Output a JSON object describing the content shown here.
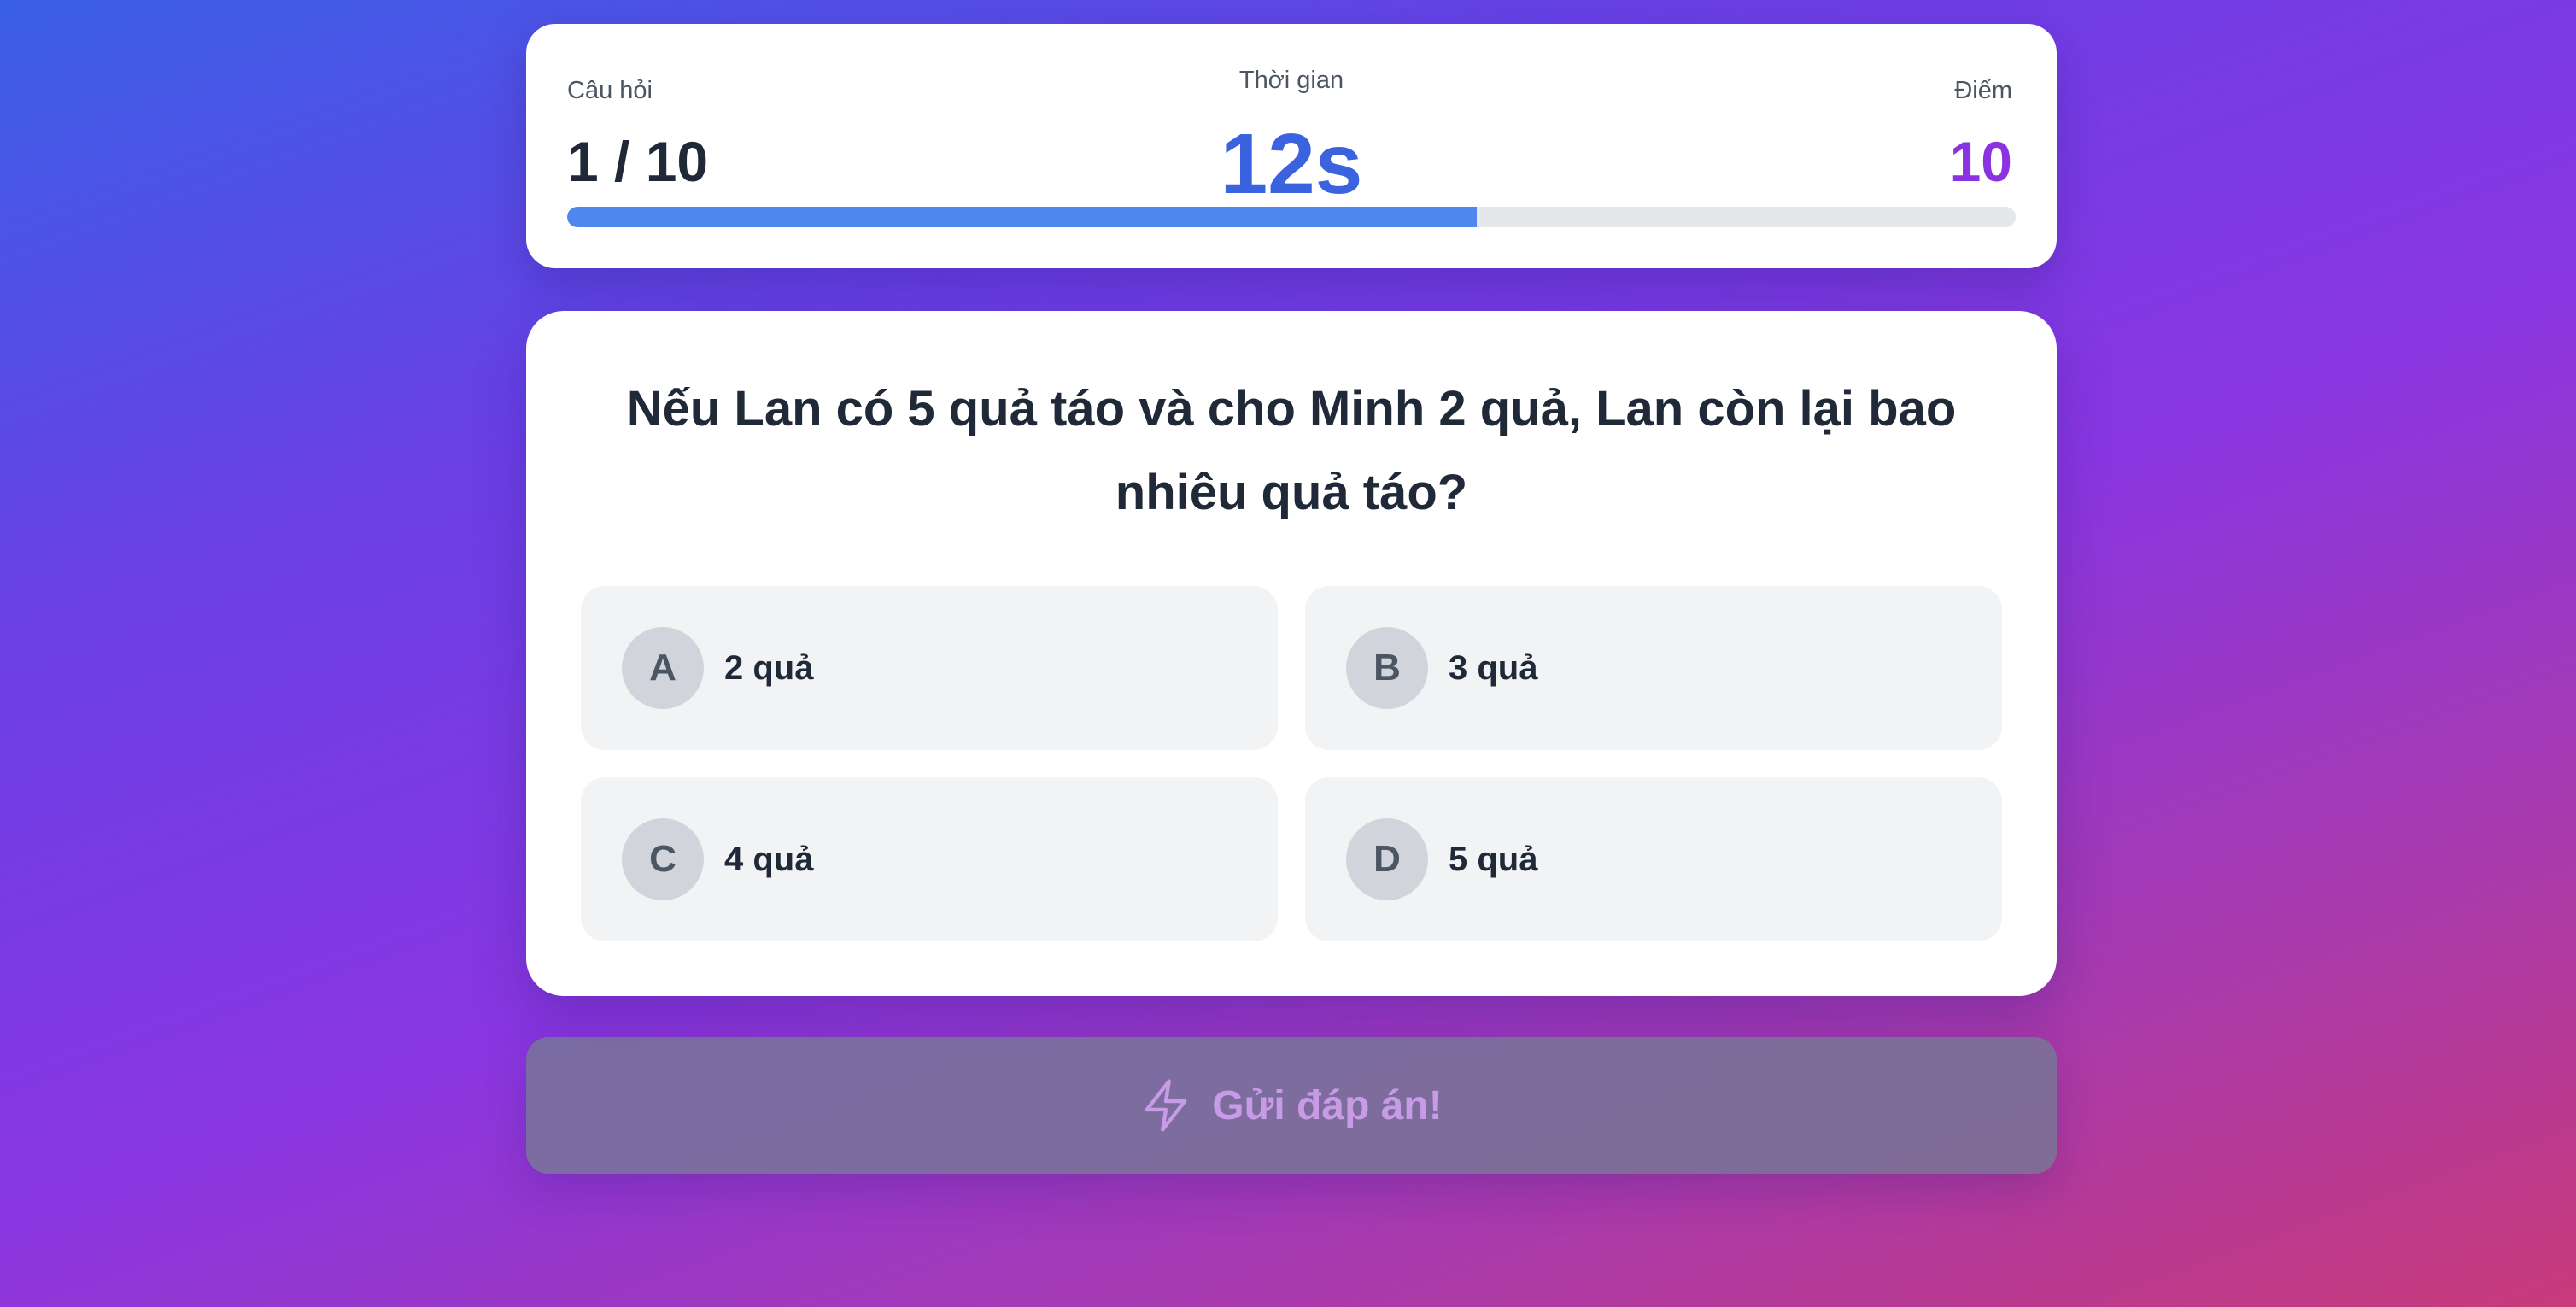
{
  "stats": {
    "question_label": "Câu hỏi",
    "question_value": "1 / 10",
    "timer_label": "Thời gian",
    "timer_value": "12s",
    "score_label": "Điểm",
    "score_value": "10",
    "progress_fraction": 0.628
  },
  "question": {
    "text": "Nếu Lan có 5 quả táo và cho Minh 2 quả, Lan còn lại bao nhiêu quả táo?"
  },
  "options": [
    {
      "letter": "A",
      "text": "2 quả"
    },
    {
      "letter": "B",
      "text": "3 quả"
    },
    {
      "letter": "C",
      "text": "4 quả"
    },
    {
      "letter": "D",
      "text": "5 quả"
    }
  ],
  "submit": {
    "label": "Gửi đáp án!",
    "icon": "bolt-icon",
    "enabled": false
  },
  "colors": {
    "timer": "#3b63e0",
    "score": "#8b33e0",
    "progress": "#4f86ef",
    "submit_text": "#c79be6"
  }
}
